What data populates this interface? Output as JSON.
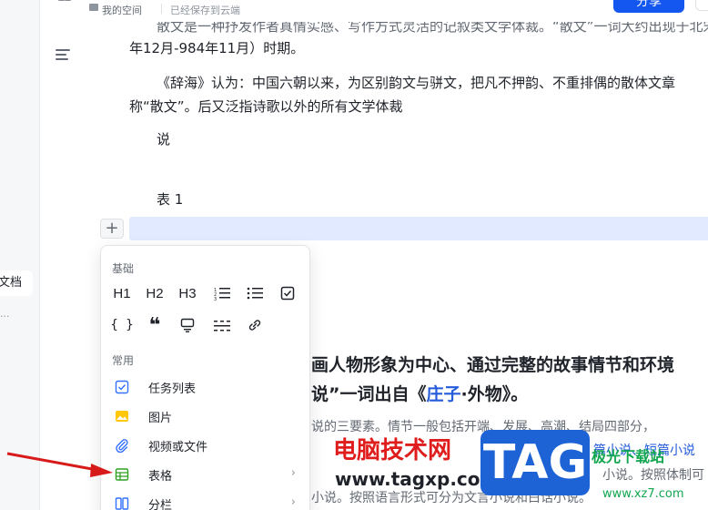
{
  "header": {
    "space_label": "我的空间",
    "saved_label": "已经保存到云端",
    "share_label": "分享"
  },
  "sidebar": {
    "item_label": "文档",
    "sub_label": "..."
  },
  "document": {
    "line_top": "散文是一种抒发作者真情实感、写作方式灵活的记叙类文学体裁。“散文”一词大约出现于北宋",
    "line_2": "年12月-984年11月）时期。",
    "line_3": "《辞海》认为：中国六朝以来，为区别韵文与骈文，把凡不押韵、不重排偶的散体文章",
    "line_4": "称“散文”。后又泛指诗歌以外的所有文学体裁",
    "line_5": "说",
    "line_6": "表 1",
    "heading_1": "画人物形象为中心、通过完整的故事情节和环境",
    "heading_2_pre": "说”一词出自《",
    "heading_2_link": "庄子",
    "heading_2_post": "·外物》。",
    "body_1": "说的三要素。情节一般包括开端、发展、高潮、结局四部分，",
    "body_2": "篇小说、短篇小说",
    "body_3": "小说。按照体制可",
    "body_4": "小说。按照语言形式可分为文言小说和白话小说。"
  },
  "menu": {
    "section_basic": "基础",
    "section_common": "常用",
    "tools_row1": [
      "H1",
      "H2",
      "H3",
      "ordered-list",
      "bullet-list",
      "checkbox"
    ],
    "tools_row2": [
      "{ }",
      "❝",
      "callout",
      "divider",
      "link"
    ],
    "items": [
      {
        "label": "任务列表",
        "icon": "task-icon",
        "arrow": false
      },
      {
        "label": "图片",
        "icon": "image-icon",
        "arrow": false
      },
      {
        "label": "视频或文件",
        "icon": "attachment-icon",
        "arrow": false
      },
      {
        "label": "表格",
        "icon": "table-icon",
        "arrow": true
      },
      {
        "label": "分栏",
        "icon": "columns-icon",
        "arrow": true
      }
    ]
  },
  "watermark": {
    "title": "电脑技术网",
    "url": "www.tagxp.com",
    "logo": "TAG",
    "site": "极光下载站",
    "site_url": "www.xz7.com"
  },
  "colors": {
    "accent": "#1456f0",
    "highlight": "#e1eaff",
    "link": "#245bdb"
  }
}
